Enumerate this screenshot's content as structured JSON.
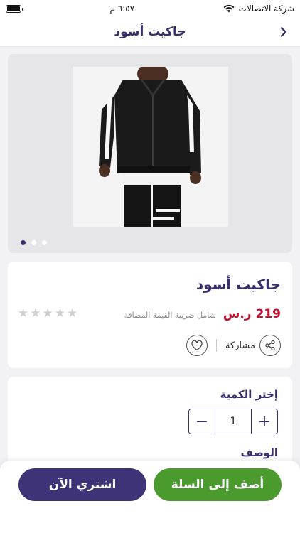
{
  "status_bar": {
    "carrier": "شركة الاتصالات",
    "time": "٦:٥٧ م",
    "battery_level": 1.0
  },
  "nav": {
    "title": "جاكيت أسود",
    "back_icon": "chevron-right-icon"
  },
  "gallery": {
    "image_alt": "black jacket product photo",
    "page_count": 3,
    "active_page": 1
  },
  "product": {
    "name": "جاكيت أسود",
    "price": "219 ر.س",
    "price_note": "شامل ضريبة القيمة المضافة",
    "rating": 0,
    "rating_max": 5,
    "share_label": "مشاركة"
  },
  "quantity": {
    "label": "إختر الكمية",
    "value": "1",
    "minus": "−",
    "plus": "+"
  },
  "description": {
    "label": "الوصف"
  },
  "actions": {
    "add_to_cart": "أضف إلى السلة",
    "buy_now": "اشتري الآن"
  },
  "colors": {
    "brand_purple": "#3f3377",
    "accent_green": "#4a9a2e",
    "price_red": "#c8102e"
  }
}
